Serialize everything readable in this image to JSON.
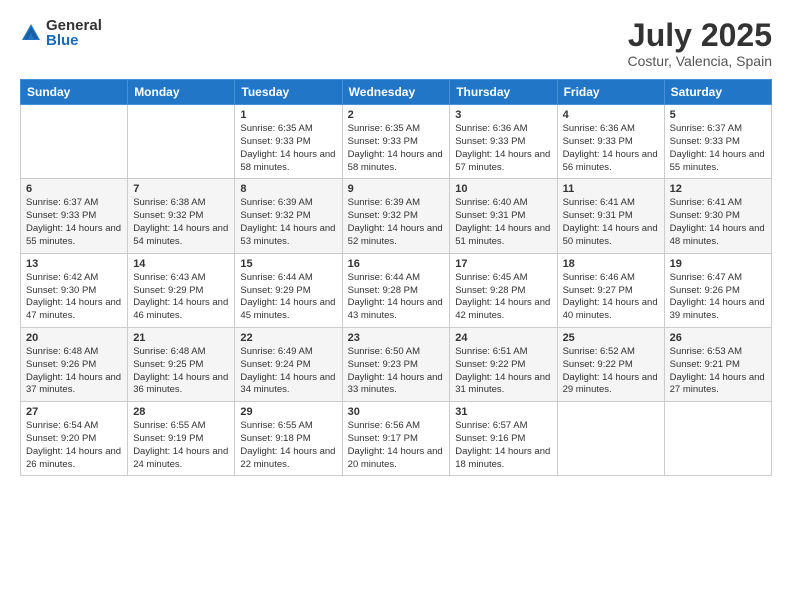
{
  "logo": {
    "general": "General",
    "blue": "Blue"
  },
  "header": {
    "title": "July 2025",
    "subtitle": "Costur, Valencia, Spain"
  },
  "weekdays": [
    "Sunday",
    "Monday",
    "Tuesday",
    "Wednesday",
    "Thursday",
    "Friday",
    "Saturday"
  ],
  "weeks": [
    [
      {
        "day": "",
        "info": ""
      },
      {
        "day": "",
        "info": ""
      },
      {
        "day": "1",
        "info": "Sunrise: 6:35 AM\nSunset: 9:33 PM\nDaylight: 14 hours\nand 58 minutes."
      },
      {
        "day": "2",
        "info": "Sunrise: 6:35 AM\nSunset: 9:33 PM\nDaylight: 14 hours\nand 58 minutes."
      },
      {
        "day": "3",
        "info": "Sunrise: 6:36 AM\nSunset: 9:33 PM\nDaylight: 14 hours\nand 57 minutes."
      },
      {
        "day": "4",
        "info": "Sunrise: 6:36 AM\nSunset: 9:33 PM\nDaylight: 14 hours\nand 56 minutes."
      },
      {
        "day": "5",
        "info": "Sunrise: 6:37 AM\nSunset: 9:33 PM\nDaylight: 14 hours\nand 55 minutes."
      }
    ],
    [
      {
        "day": "6",
        "info": "Sunrise: 6:37 AM\nSunset: 9:33 PM\nDaylight: 14 hours\nand 55 minutes."
      },
      {
        "day": "7",
        "info": "Sunrise: 6:38 AM\nSunset: 9:32 PM\nDaylight: 14 hours\nand 54 minutes."
      },
      {
        "day": "8",
        "info": "Sunrise: 6:39 AM\nSunset: 9:32 PM\nDaylight: 14 hours\nand 53 minutes."
      },
      {
        "day": "9",
        "info": "Sunrise: 6:39 AM\nSunset: 9:32 PM\nDaylight: 14 hours\nand 52 minutes."
      },
      {
        "day": "10",
        "info": "Sunrise: 6:40 AM\nSunset: 9:31 PM\nDaylight: 14 hours\nand 51 minutes."
      },
      {
        "day": "11",
        "info": "Sunrise: 6:41 AM\nSunset: 9:31 PM\nDaylight: 14 hours\nand 50 minutes."
      },
      {
        "day": "12",
        "info": "Sunrise: 6:41 AM\nSunset: 9:30 PM\nDaylight: 14 hours\nand 48 minutes."
      }
    ],
    [
      {
        "day": "13",
        "info": "Sunrise: 6:42 AM\nSunset: 9:30 PM\nDaylight: 14 hours\nand 47 minutes."
      },
      {
        "day": "14",
        "info": "Sunrise: 6:43 AM\nSunset: 9:29 PM\nDaylight: 14 hours\nand 46 minutes."
      },
      {
        "day": "15",
        "info": "Sunrise: 6:44 AM\nSunset: 9:29 PM\nDaylight: 14 hours\nand 45 minutes."
      },
      {
        "day": "16",
        "info": "Sunrise: 6:44 AM\nSunset: 9:28 PM\nDaylight: 14 hours\nand 43 minutes."
      },
      {
        "day": "17",
        "info": "Sunrise: 6:45 AM\nSunset: 9:28 PM\nDaylight: 14 hours\nand 42 minutes."
      },
      {
        "day": "18",
        "info": "Sunrise: 6:46 AM\nSunset: 9:27 PM\nDaylight: 14 hours\nand 40 minutes."
      },
      {
        "day": "19",
        "info": "Sunrise: 6:47 AM\nSunset: 9:26 PM\nDaylight: 14 hours\nand 39 minutes."
      }
    ],
    [
      {
        "day": "20",
        "info": "Sunrise: 6:48 AM\nSunset: 9:26 PM\nDaylight: 14 hours\nand 37 minutes."
      },
      {
        "day": "21",
        "info": "Sunrise: 6:48 AM\nSunset: 9:25 PM\nDaylight: 14 hours\nand 36 minutes."
      },
      {
        "day": "22",
        "info": "Sunrise: 6:49 AM\nSunset: 9:24 PM\nDaylight: 14 hours\nand 34 minutes."
      },
      {
        "day": "23",
        "info": "Sunrise: 6:50 AM\nSunset: 9:23 PM\nDaylight: 14 hours\nand 33 minutes."
      },
      {
        "day": "24",
        "info": "Sunrise: 6:51 AM\nSunset: 9:22 PM\nDaylight: 14 hours\nand 31 minutes."
      },
      {
        "day": "25",
        "info": "Sunrise: 6:52 AM\nSunset: 9:22 PM\nDaylight: 14 hours\nand 29 minutes."
      },
      {
        "day": "26",
        "info": "Sunrise: 6:53 AM\nSunset: 9:21 PM\nDaylight: 14 hours\nand 27 minutes."
      }
    ],
    [
      {
        "day": "27",
        "info": "Sunrise: 6:54 AM\nSunset: 9:20 PM\nDaylight: 14 hours\nand 26 minutes."
      },
      {
        "day": "28",
        "info": "Sunrise: 6:55 AM\nSunset: 9:19 PM\nDaylight: 14 hours\nand 24 minutes."
      },
      {
        "day": "29",
        "info": "Sunrise: 6:55 AM\nSunset: 9:18 PM\nDaylight: 14 hours\nand 22 minutes."
      },
      {
        "day": "30",
        "info": "Sunrise: 6:56 AM\nSunset: 9:17 PM\nDaylight: 14 hours\nand 20 minutes."
      },
      {
        "day": "31",
        "info": "Sunrise: 6:57 AM\nSunset: 9:16 PM\nDaylight: 14 hours\nand 18 minutes."
      },
      {
        "day": "",
        "info": ""
      },
      {
        "day": "",
        "info": ""
      }
    ]
  ]
}
